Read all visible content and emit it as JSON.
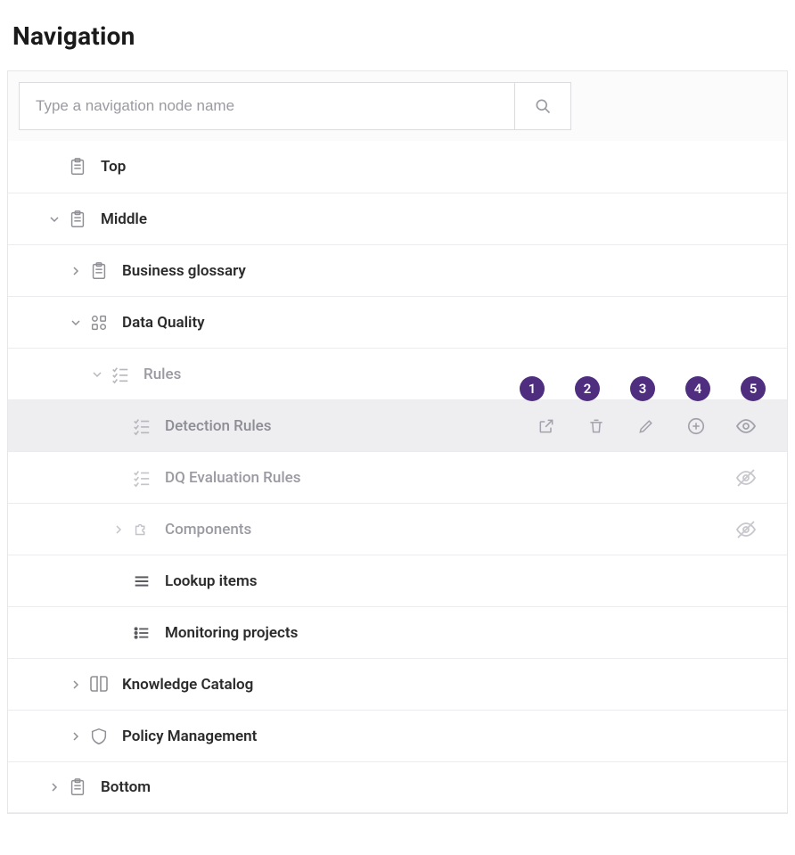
{
  "title": "Navigation",
  "search": {
    "placeholder": "Type a navigation node name"
  },
  "nodes": {
    "top": "Top",
    "middle": "Middle",
    "business_glossary": "Business glossary",
    "data_quality": "Data Quality",
    "rules": "Rules",
    "detection_rules": "Detection Rules",
    "dq_evaluation_rules": "DQ Evaluation Rules",
    "components": "Components",
    "lookup_items": "Lookup items",
    "monitoring_projects": "Monitoring projects",
    "knowledge_catalog": "Knowledge Catalog",
    "policy_management": "Policy Management",
    "bottom": "Bottom"
  },
  "callouts": [
    "1",
    "2",
    "3",
    "4",
    "5"
  ],
  "colors": {
    "callout_bg": "#4f2d7f"
  }
}
